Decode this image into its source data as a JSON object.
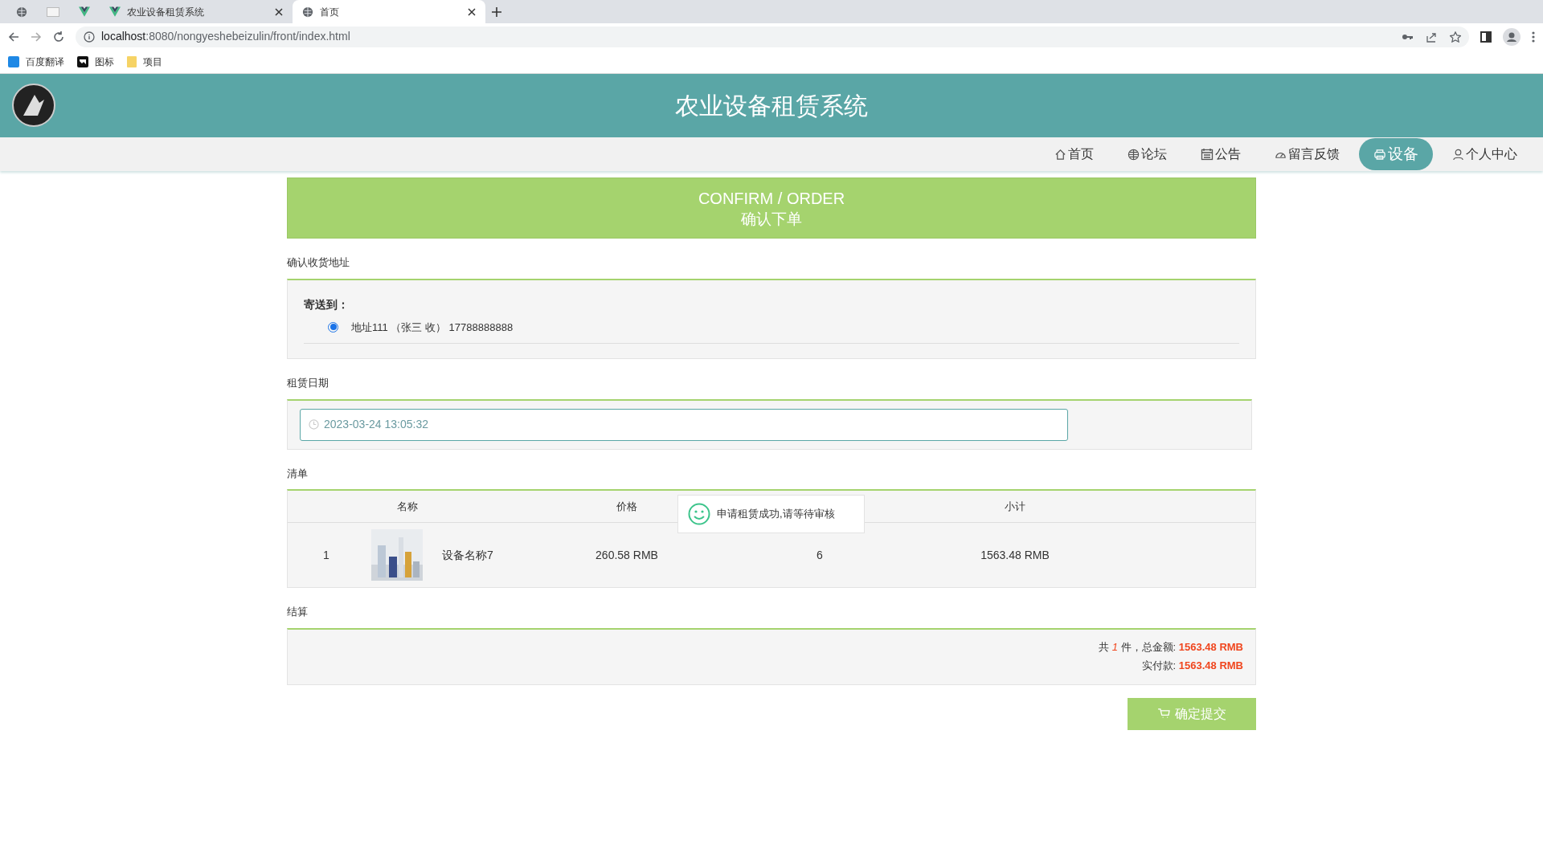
{
  "browser": {
    "tabs": [
      {
        "kind": "icon",
        "selected": false
      },
      {
        "kind": "icon",
        "selected": false
      },
      {
        "kind": "icon",
        "selected": false
      },
      {
        "kind": "full",
        "label": "农业设备租赁系统",
        "selected": false
      },
      {
        "kind": "full",
        "label": "首页",
        "selected": true
      }
    ],
    "url_host": "localhost",
    "url_rest": ":8080/nongyeshebeizulin/front/index.html",
    "bookmarks": [
      {
        "label": "百度翻译"
      },
      {
        "label": "图标"
      },
      {
        "label": "项目"
      }
    ]
  },
  "site": {
    "title": "农业设备租赁系统"
  },
  "nav": [
    {
      "label": "首页",
      "selected": false
    },
    {
      "label": "论坛",
      "selected": false
    },
    {
      "label": "公告",
      "selected": false
    },
    {
      "label": "留言反馈",
      "selected": false
    },
    {
      "label": "设备",
      "selected": true
    },
    {
      "label": "个人中心",
      "selected": false
    }
  ],
  "banner": {
    "title": "CONFIRM / ORDER",
    "subtitle": "确认下单"
  },
  "address_section": {
    "heading": "确认收货地址",
    "label": "寄送到：",
    "options": [
      {
        "text": "地址111 （张三 收） 17788888888",
        "selected": true
      }
    ]
  },
  "date_section": {
    "heading": "租赁日期",
    "value": "2023-03-24 13:05:32"
  },
  "list_section": {
    "heading": "清单",
    "columns": [
      "名称",
      "价格",
      "小计"
    ],
    "rows": [
      {
        "index": "1",
        "name": "设备名称7",
        "price": "260.58 RMB",
        "quantity": "6",
        "subtotal": "1563.48 RMB"
      }
    ]
  },
  "summary": {
    "heading": "结算",
    "count_prefix": "共",
    "count": "1",
    "count_suffix": "件，总金额:",
    "total": "1563.48 RMB",
    "paid_label": "实付款:",
    "paid": "1563.48 RMB"
  },
  "submit_button": "确定提交",
  "toast": {
    "message": "申请租赁成功,请等待审核"
  }
}
